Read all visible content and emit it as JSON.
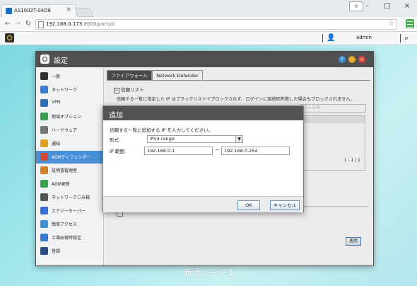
{
  "browser": {
    "tab_title": "AS1002T-04D8",
    "tab_close": "×",
    "window_controls": [
      "–",
      "□",
      "×"
    ],
    "profile_label": "◎",
    "url_host": "192.168.0.173",
    "url_rest": ":8000/portal/"
  },
  "adm": {
    "username": "admin"
  },
  "desktop": {
    "page_label": "新規ページ 1"
  },
  "settings": {
    "title": "設定",
    "sidebar": [
      {
        "label": "一般",
        "icon": "general-icon",
        "color": "#333333"
      },
      {
        "label": "ネットワーク",
        "icon": "network-icon",
        "color": "#3a7bd5"
      },
      {
        "label": "VPN",
        "icon": "vpn-icon",
        "color": "#2c6fb6"
      },
      {
        "label": "地域オプション",
        "icon": "region-icon",
        "color": "#35a04a"
      },
      {
        "label": "ハードウェア",
        "icon": "hardware-icon",
        "color": "#777777"
      },
      {
        "label": "通知",
        "icon": "notification-icon",
        "color": "#e0a020"
      },
      {
        "label": "ADMディフェンダー",
        "icon": "defender-icon",
        "color": "#d04a3a"
      },
      {
        "label": "証明書管理者",
        "icon": "certificate-icon",
        "color": "#d0802a"
      },
      {
        "label": "ADM更新",
        "icon": "update-icon",
        "color": "#3aa04a"
      },
      {
        "label": "ネットワークごみ箱",
        "icon": "recycle-bin-icon",
        "color": "#555555"
      },
      {
        "label": "エナジーセーバー",
        "icon": "energy-icon",
        "color": "#3a6fd5"
      },
      {
        "label": "簡単アクセス",
        "icon": "easy-access-icon",
        "color": "#3a8fd5"
      },
      {
        "label": "工場出荷時設定",
        "icon": "factory-reset-icon",
        "color": "#3a7bd5"
      },
      {
        "label": "登録",
        "icon": "register-icon",
        "color": "#2a4f86"
      }
    ],
    "active_index": 6,
    "tabs": [
      "ファイアウォール",
      "Network Defender"
    ],
    "section_title": "信頼リスト",
    "section_marker": "−",
    "description": "信頼する一覧に指定した IP はブラックリストでブロックされず、ログインに接続回失敗した場合もブロックされません。",
    "filter_placeholder": "フィルタ",
    "pager": "1 - 1 / 1",
    "apply_label": "適用",
    "accent": "#4a90d9"
  },
  "dialog": {
    "title": "追加",
    "instruction": "信頼する一覧に追加する IP を入力してください。",
    "format_label": "形式:",
    "format_value": "IPv4 range",
    "ip_label": "IP 範囲:",
    "ip_start": "192.168.0.1",
    "ip_separator": "~",
    "ip_end": "192.168.0.254",
    "ok_label": "OK",
    "cancel_label": "キャンセル"
  }
}
